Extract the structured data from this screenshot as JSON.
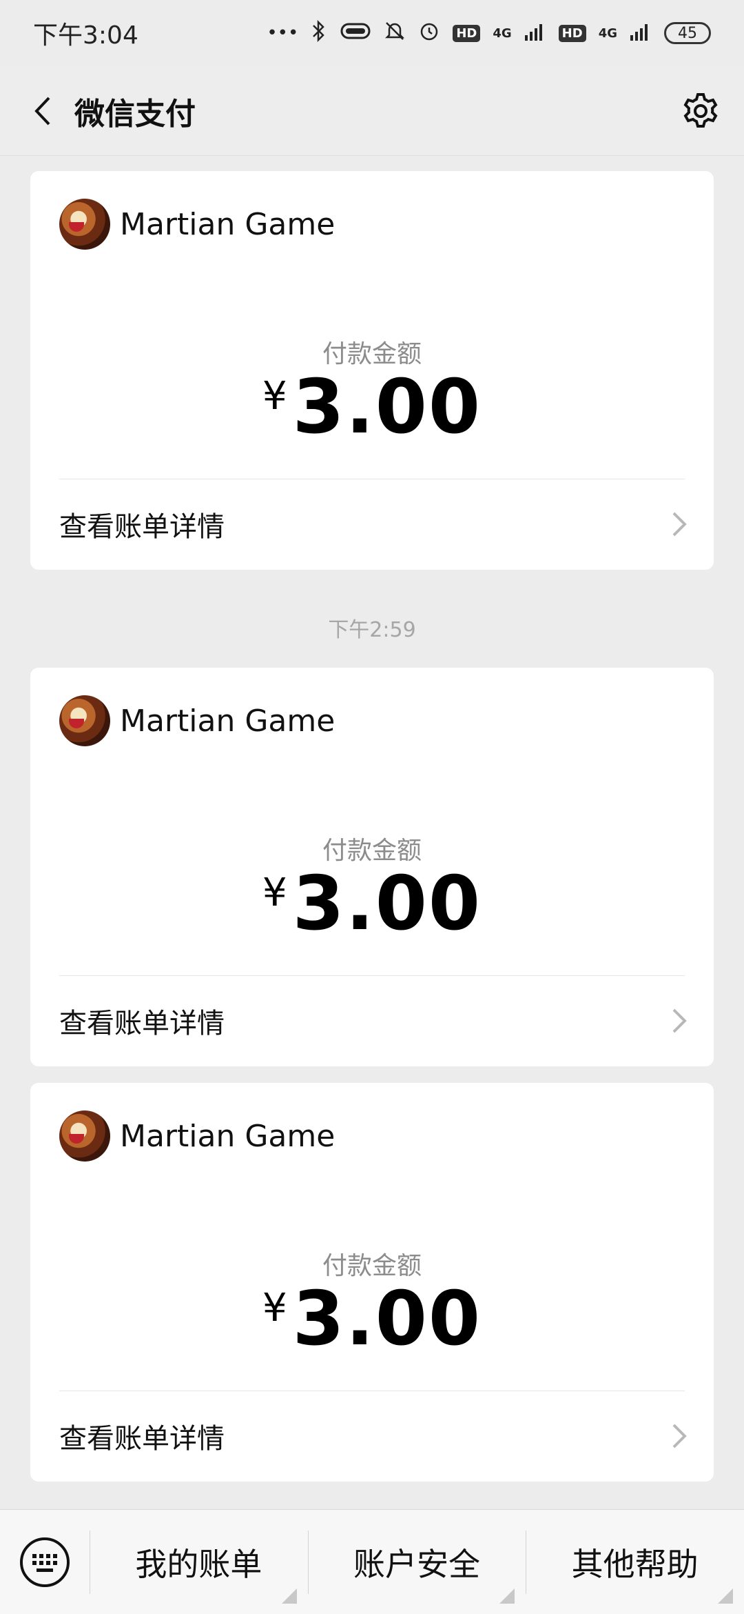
{
  "status_bar": {
    "time": "下午3:04",
    "hd1": "HD",
    "net1": "4G",
    "hd2": "HD",
    "net2": "4G",
    "battery": "45"
  },
  "navbar": {
    "title": "微信支付"
  },
  "cards": [
    {
      "merchant": "Martian Game",
      "amount_label": "付款金额",
      "currency": "¥",
      "amount": "3.00",
      "detail_label": "查看账单详情"
    },
    {
      "merchant": "Martian Game",
      "amount_label": "付款金额",
      "currency": "¥",
      "amount": "3.00",
      "detail_label": "查看账单详情"
    },
    {
      "merchant": "Martian Game",
      "amount_label": "付款金额",
      "currency": "¥",
      "amount": "3.00",
      "detail_label": "查看账单详情"
    }
  ],
  "timestamp": "下午2:59",
  "bottom_menu": {
    "items": [
      {
        "label": "我的账单"
      },
      {
        "label": "账户安全"
      },
      {
        "label": "其他帮助"
      }
    ]
  }
}
